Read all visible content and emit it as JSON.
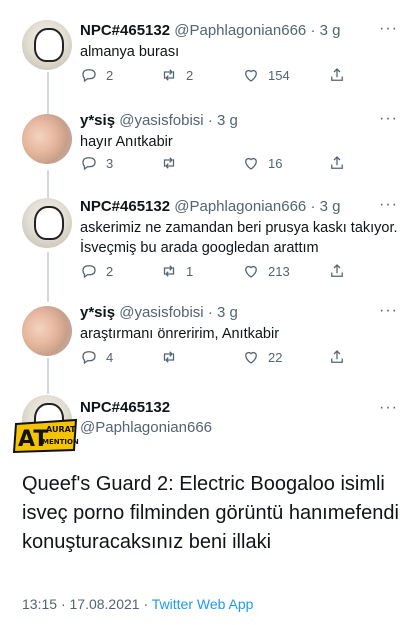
{
  "tweets": [
    {
      "name": "NPC#465132",
      "handle": "@Paphlagonian666",
      "time": "3 g",
      "text": "almanya burası",
      "replies": "2",
      "retweets": "2",
      "likes": "154",
      "avatar_icon": "npc-meme-avatar"
    },
    {
      "name": "y*siş",
      "handle": "@yasisfobisi",
      "time": "3 g",
      "text": "hayır Anıtkabir",
      "replies": "3",
      "retweets": "",
      "likes": "16",
      "avatar_icon": "photo-avatar"
    },
    {
      "name": "NPC#465132",
      "handle": "@Paphlagonian666",
      "time": "3 g",
      "text": "askerimiz ne zamandan beri prusya kaskı takıyor. İsveçmiş bu arada googledan arattım",
      "replies": "2",
      "retweets": "1",
      "likes": "213",
      "avatar_icon": "npc-meme-avatar"
    },
    {
      "name": "y*siş",
      "handle": "@yasisfobisi",
      "time": "3 g",
      "text": "araştırmanı önreririm, Anıtkabir",
      "replies": "4",
      "retweets": "",
      "likes": "22",
      "avatar_icon": "photo-avatar"
    }
  ],
  "main_tweet": {
    "name": "NPC#465132",
    "handle": "@Paphlagonian666",
    "text": "Queef's Guard 2: Electric Boogaloo isimli isveç porno filminden görüntü hanımefendi konuşturacaksınız beni illaki",
    "time": "13:15",
    "date": "17.08.2021",
    "source": "Twitter Web App",
    "badge_main": "AT",
    "badge_top": "AURAT",
    "badge_bottom": "MENTION"
  },
  "separator": "·",
  "more_glyph": "···",
  "colors": {
    "text": "#0f1419",
    "secondary": "#536471",
    "link": "#1d9bf0",
    "thread": "#cfd9de"
  }
}
